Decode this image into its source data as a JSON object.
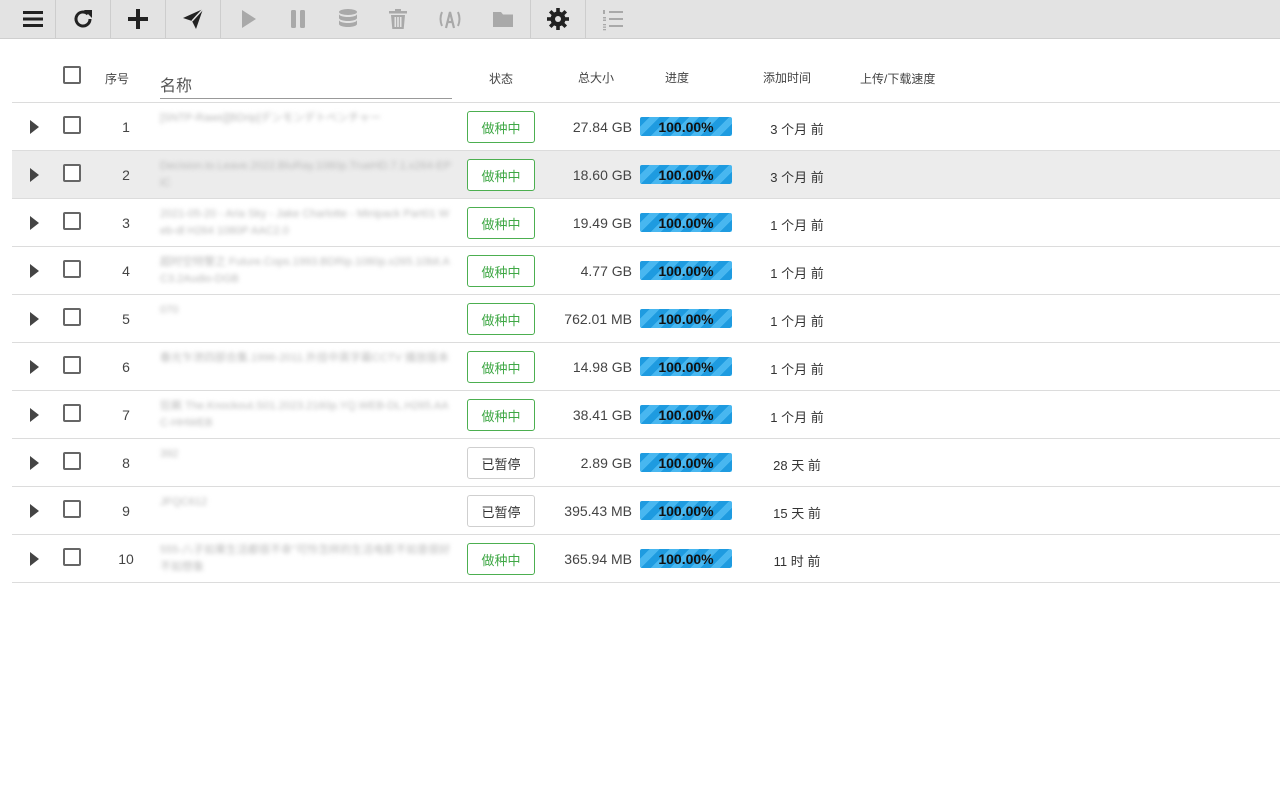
{
  "toolbar": {
    "buttons": [
      {
        "icon": "menu-icon"
      },
      {
        "icon": "refresh-icon"
      },
      {
        "icon": "add-icon"
      },
      {
        "icon": "send-icon"
      },
      {
        "icon": "play-icon"
      },
      {
        "icon": "pause-icon"
      },
      {
        "icon": "database-icon"
      },
      {
        "icon": "trash-icon"
      },
      {
        "icon": "tracker-announce-icon"
      },
      {
        "icon": "folder-icon"
      },
      {
        "icon": "gear-icon"
      },
      {
        "icon": "ordered-list-icon"
      }
    ]
  },
  "table": {
    "headers": {
      "index": "序号",
      "name": "名称",
      "status": "状态",
      "size": "总大小",
      "progress": "进度",
      "added": "添加时间",
      "speed": "上传/下载速度"
    },
    "rows": [
      {
        "index": "1",
        "name": "[SNTP-Raws][BDrip]デンモンデトベンチャー",
        "status": "做种中",
        "size": "27.84 GB",
        "progress": "100.00%",
        "progress_value": 100,
        "added": "3 个月 前",
        "state": "seeding"
      },
      {
        "index": "2",
        "name": "Decision.to.Leave.2022.BluRay.1080p.TrueHD.7.1.x264-EPiC",
        "status": "做种中",
        "size": "18.60 GB",
        "progress": "100.00%",
        "progress_value": 100,
        "added": "3 个月 前",
        "state": "seeding"
      },
      {
        "index": "3",
        "name": "2021-05-20 - Aria Sky - Jake Charlotte - Minipack Part01 Web-dl H264 1080P AAC2.0",
        "status": "做种中",
        "size": "19.49 GB",
        "progress": "100.00%",
        "progress_value": 100,
        "added": "1 个月 前",
        "state": "seeding"
      },
      {
        "index": "4",
        "name": "超时空特警之 Future.Cops.1993.BDRip.1080p.x265.10bit.AC3.2Audio-DGB",
        "status": "做种中",
        "size": "4.77 GB",
        "progress": "100.00%",
        "progress_value": 100,
        "added": "1 个月 前",
        "state": "seeding"
      },
      {
        "index": "5",
        "name": "070",
        "status": "做种中",
        "size": "762.01 MB",
        "progress": "100.00%",
        "progress_value": 100,
        "added": "1 个月 前",
        "state": "seeding"
      },
      {
        "index": "6",
        "name": "春光乍泄四部合集.1996-2011.外挂中英字幕CCTV 播放版本",
        "status": "做种中",
        "size": "14.98 GB",
        "progress": "100.00%",
        "progress_value": 100,
        "added": "1 个月 前",
        "state": "seeding"
      },
      {
        "index": "7",
        "name": "狂飙 The.Knockout.S01.2023.2160p.YQ.WEB-DL.H265.AAC-HHWEB",
        "status": "做种中",
        "size": "38.41 GB",
        "progress": "100.00%",
        "progress_value": 100,
        "added": "1 个月 前",
        "state": "seeding"
      },
      {
        "index": "8",
        "name": "392",
        "status": "已暂停",
        "size": "2.89 GB",
        "progress": "100.00%",
        "progress_value": 100,
        "added": "28 天 前",
        "state": "paused"
      },
      {
        "index": "9",
        "name": "JFQC612",
        "status": "已暂停",
        "size": "395.43 MB",
        "progress": "100.00%",
        "progress_value": 100,
        "added": "15 天 前",
        "state": "paused"
      },
      {
        "index": "10",
        "name": "555-八子如果生活都很不幸''可怜怎样的生活电影不如意很好不如想象",
        "status": "做种中",
        "size": "365.94 MB",
        "progress": "100.00%",
        "progress_value": 100,
        "added": "11 时 前",
        "state": "seeding"
      }
    ]
  }
}
